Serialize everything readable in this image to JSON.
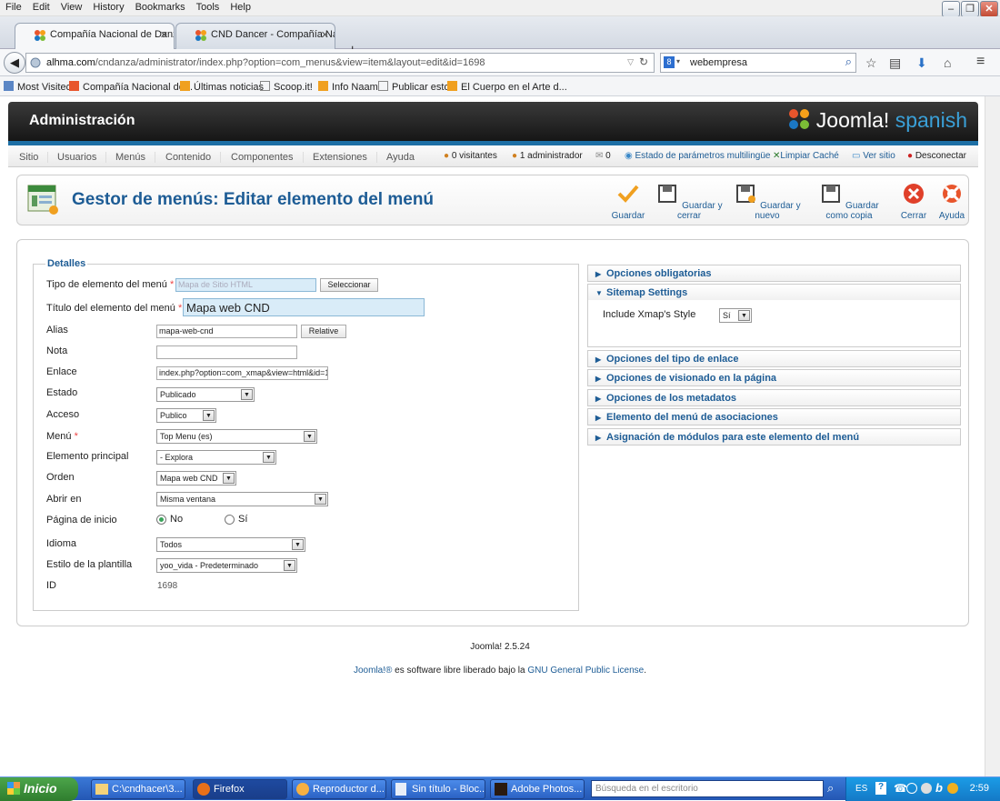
{
  "browser": {
    "menu": [
      "File",
      "Edit",
      "View",
      "History",
      "Bookmarks",
      "Tools",
      "Help"
    ],
    "tabs": [
      {
        "title": "Compañía Nacional de Danza....",
        "active": true
      },
      {
        "title": "CND Dancer - Compañía Naci...",
        "active": false
      }
    ],
    "url_domain": "alhma.com",
    "url_path": "/cndanza/administrator/index.php?option=com_menus&view=item&layout=edit&id=1698",
    "search_value": "webempresa",
    "bookmarks": [
      "Most Visited",
      "Compañía Nacional de...",
      "Últimas noticias",
      "Scoop.it!",
      "Info Naam",
      "Publicar esto",
      "El Cuerpo en el Arte d..."
    ]
  },
  "joomla": {
    "header_title": "Administración",
    "logo_text": "Joomla!",
    "logo_suffix": "spanish",
    "menu": [
      "Sitio",
      "Usuarios",
      "Menús",
      "Contenido",
      "Componentes",
      "Extensiones",
      "Ayuda"
    ],
    "status": {
      "visitors": "0 visitantes",
      "admins": "1 administrador",
      "messages": "0",
      "multilang": "Estado de parámetros multilingüe",
      "clear_cache": "Limpiar Caché",
      "view_site": "Ver sitio",
      "logout": "Desconectar"
    },
    "page_title": "Gestor de menús: Editar elemento del menú",
    "toolbar": [
      "Guardar",
      "Guardar y cerrar",
      "Guardar y nuevo",
      "Guardar como copia",
      "Cerrar",
      "Ayuda"
    ]
  },
  "details": {
    "legend": "Detalles",
    "labels": {
      "type": "Tipo de elemento del menú",
      "title": "Título del elemento del menú",
      "alias": "Alias",
      "note": "Nota",
      "link": "Enlace",
      "state": "Estado",
      "access": "Acceso",
      "menu": "Menú",
      "parent": "Elemento principal",
      "order": "Orden",
      "target": "Abrir en",
      "home": "Página de inicio",
      "language": "Idioma",
      "template": "Estilo de la plantilla",
      "id": "ID"
    },
    "values": {
      "type": "Mapa de Sitio HTML",
      "title": "Mapa web CND",
      "alias": "mapa-web-cnd",
      "note": "",
      "link": "index.php?option=com_xmap&view=html&id=1",
      "state": "Publicado",
      "access": "Publico",
      "menu": "Top Menu (es)",
      "parent": "- Explora",
      "order": "Mapa web CND",
      "target": "Misma ventana",
      "home_no": "No",
      "home_yes": "Sí",
      "language": "Todos",
      "template": "yoo_vida - Predeterminado",
      "id": "1698"
    },
    "buttons": {
      "select": "Seleccionar",
      "relative": "Relative"
    }
  },
  "panes": {
    "items": [
      "Opciones obligatorias",
      "Sitemap Settings",
      "Opciones del tipo de enlace",
      "Opciones de visionado en la página",
      "Opciones de los metadatos",
      "Elemento del menú de asociaciones",
      "Asignación de módulos para este elemento del menú"
    ],
    "sitemap_label": "Include Xmap's Style",
    "sitemap_value": "Sí"
  },
  "footer": {
    "version": "Joomla! 2.5.24",
    "joomla_link": "Joomla!®",
    "license_text": " es software libre liberado bajo la ",
    "license_link": "GNU General Public License",
    "license_end": "."
  },
  "taskbar": {
    "start": "Inicio",
    "tasks": [
      "C:\\cndhacer\\3...",
      "Firefox",
      "Reproductor d...",
      "Sin título - Bloc...",
      "Adobe Photos..."
    ],
    "search_placeholder": "Búsqueda en el escritorio",
    "lang": "ES",
    "time": "2:59"
  }
}
